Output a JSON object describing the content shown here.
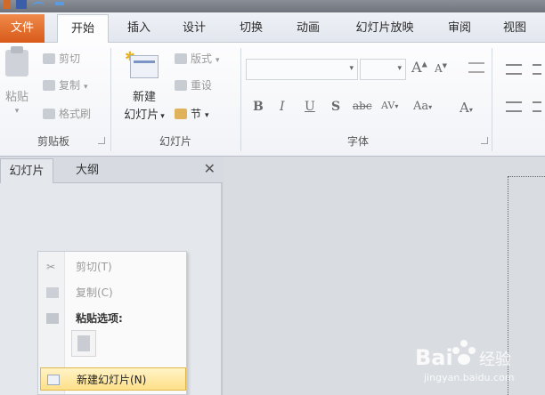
{
  "ribbon_tabs": {
    "file": "文件",
    "home": "开始",
    "insert": "插入",
    "design": "设计",
    "transitions": "切换",
    "animations": "动画",
    "slideshow": "幻灯片放映",
    "review": "审阅",
    "view": "视图"
  },
  "clipboard": {
    "paste": "粘贴",
    "cut": "剪切",
    "copy": "复制",
    "format_painter": "格式刷",
    "group_label": "剪贴板"
  },
  "slides": {
    "new_slide_line1": "新建",
    "new_slide_line2": "幻灯片",
    "layout": "版式",
    "reset": "重设",
    "section": "节",
    "group_label": "幻灯片"
  },
  "font": {
    "group_label": "字体",
    "bold": "B",
    "italic": "I",
    "underline": "U",
    "shadow": "S",
    "strike": "abc",
    "spacing": "AV",
    "case": "Aa",
    "color": "A",
    "grow": "A",
    "shrink": "A"
  },
  "left_pane": {
    "tab_slides": "幻灯片",
    "tab_outline": "大纲",
    "close": "✕"
  },
  "context_menu": {
    "cut": "剪切(T)",
    "copy": "复制(C)",
    "paste_options": "粘贴选项:",
    "new_slide": "新建幻灯片(N)"
  },
  "watermark": {
    "logo": "Bai",
    "logo_suffix": "经验",
    "url": "jingyan.baidu.com"
  },
  "colors": {
    "file_tab": "#e06a28",
    "highlight": "#ffe08a"
  }
}
